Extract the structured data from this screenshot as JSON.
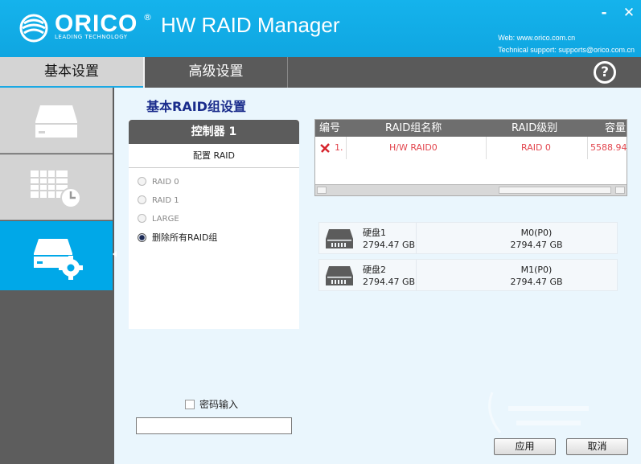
{
  "app": {
    "brand": "ORICO",
    "brand_tagline": "LEADING TECHNOLOGY",
    "brand_mark": "®",
    "title": "HW RAID Manager",
    "web": "Web: www.orico.com.cn",
    "support": "Technical support: supports@orico.com.cn"
  },
  "window": {
    "minimize_label": "-",
    "close_label": "✕"
  },
  "tabs": [
    {
      "label": "基本设置",
      "active": true
    },
    {
      "label": "高级设置",
      "active": false
    }
  ],
  "help_label": "?",
  "sidebar": {
    "items": [
      {
        "icon": "disk-drive-icon",
        "active": false
      },
      {
        "icon": "grid-clock-icon",
        "active": false
      },
      {
        "icon": "disk-gear-icon",
        "active": true
      }
    ]
  },
  "section_title": "基本RAID组设置",
  "controller": {
    "title": "控制器 1",
    "subtitle": "配置 RAID",
    "options": [
      {
        "label": "RAID 0",
        "selected": false
      },
      {
        "label": "RAID 1",
        "selected": false
      },
      {
        "label": "LARGE",
        "selected": false
      },
      {
        "label": "删除所有RAID组",
        "selected": true
      }
    ]
  },
  "password": {
    "label": "密码输入",
    "checked": false,
    "value": ""
  },
  "raid_table": {
    "columns": [
      "编号",
      "RAID组名称",
      "RAID级别",
      "容量"
    ],
    "rows": [
      {
        "index": "1.",
        "name": "H/W RAID0",
        "level": "RAID 0",
        "capacity": "5588.94"
      }
    ]
  },
  "disks": [
    {
      "name": "硬盘1",
      "size": "2794.47 GB",
      "member": "M0(P0)",
      "member_size": "2794.47 GB"
    },
    {
      "name": "硬盘2",
      "size": "2794.47 GB",
      "member": "M1(P0)",
      "member_size": "2794.47 GB"
    }
  ],
  "buttons": {
    "apply": "应用",
    "cancel": "取消"
  },
  "colors": {
    "accent": "#00a8e8",
    "header": "#15b3ec",
    "title_blue": "#1a2c8c",
    "row_red": "#e2454d"
  }
}
